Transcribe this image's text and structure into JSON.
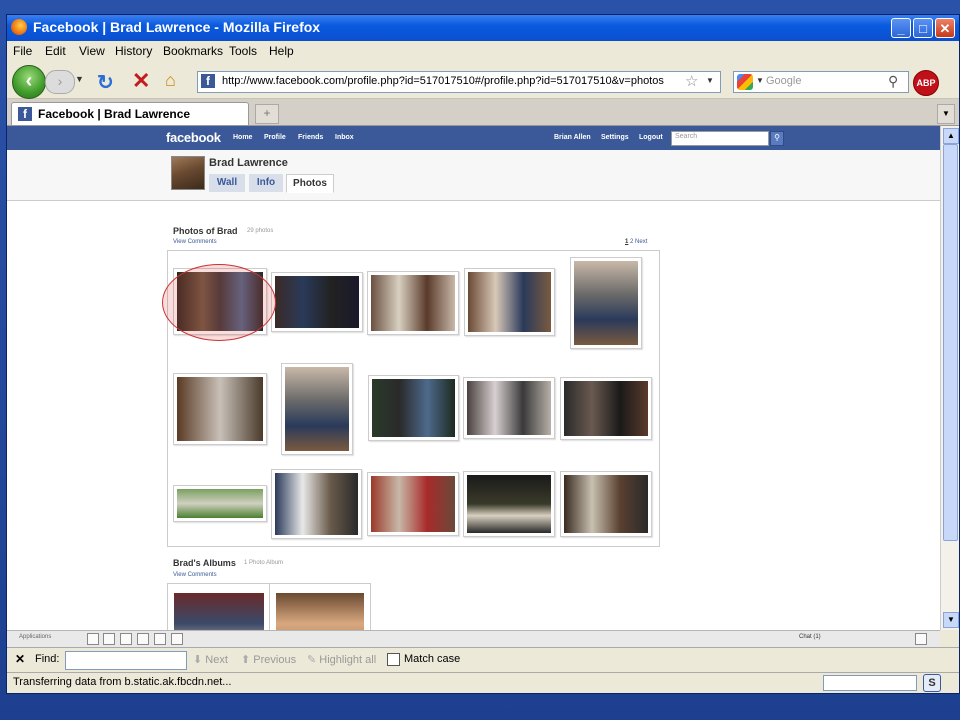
{
  "window": {
    "title": "Facebook | Brad Lawrence - Mozilla Firefox",
    "min": "_",
    "max": "□",
    "close": "✕"
  },
  "menu": [
    "File",
    "Edit",
    "View",
    "History",
    "Bookmarks",
    "Tools",
    "Help"
  ],
  "toolbar": {
    "url": "http://www.facebook.com/profile.php?id=517017510#/profile.php?id=517017510&v=photos",
    "search_placeholder": "Google",
    "abp": "ABP"
  },
  "tab": {
    "title": "Facebook | Brad Lawrence"
  },
  "fb": {
    "logo": "facebook",
    "nav": [
      "Home",
      "Profile",
      "Friends",
      "Inbox"
    ],
    "right_nav": [
      "Brian Allen",
      "Settings",
      "Logout"
    ],
    "search_placeholder": "Search"
  },
  "profile": {
    "name": "Brad Lawrence",
    "tabs": [
      "Wall",
      "Info",
      "Photos"
    ]
  },
  "photos": {
    "heading": "Photos of Brad",
    "count": "29 photos",
    "view_comments": "View Comments",
    "page_current": "1",
    "page_next": "2",
    "next": "Next"
  },
  "albums": {
    "heading": "Brad's Albums",
    "count": "1 Photo Album",
    "view_comments": "View Comments"
  },
  "footer": {
    "applications": "Applications",
    "chat": "Chat (1)"
  },
  "find": {
    "close": "✕",
    "label": "Find:",
    "next": "Next",
    "previous": "Previous",
    "highlight": "Highlight all",
    "match_case": "Match case"
  },
  "status": {
    "text": "Transferring data from b.static.ak.fbcdn.net..."
  },
  "colors": {
    "fb_blue": "#3b5998",
    "highlight_circle": "#cc3333"
  }
}
